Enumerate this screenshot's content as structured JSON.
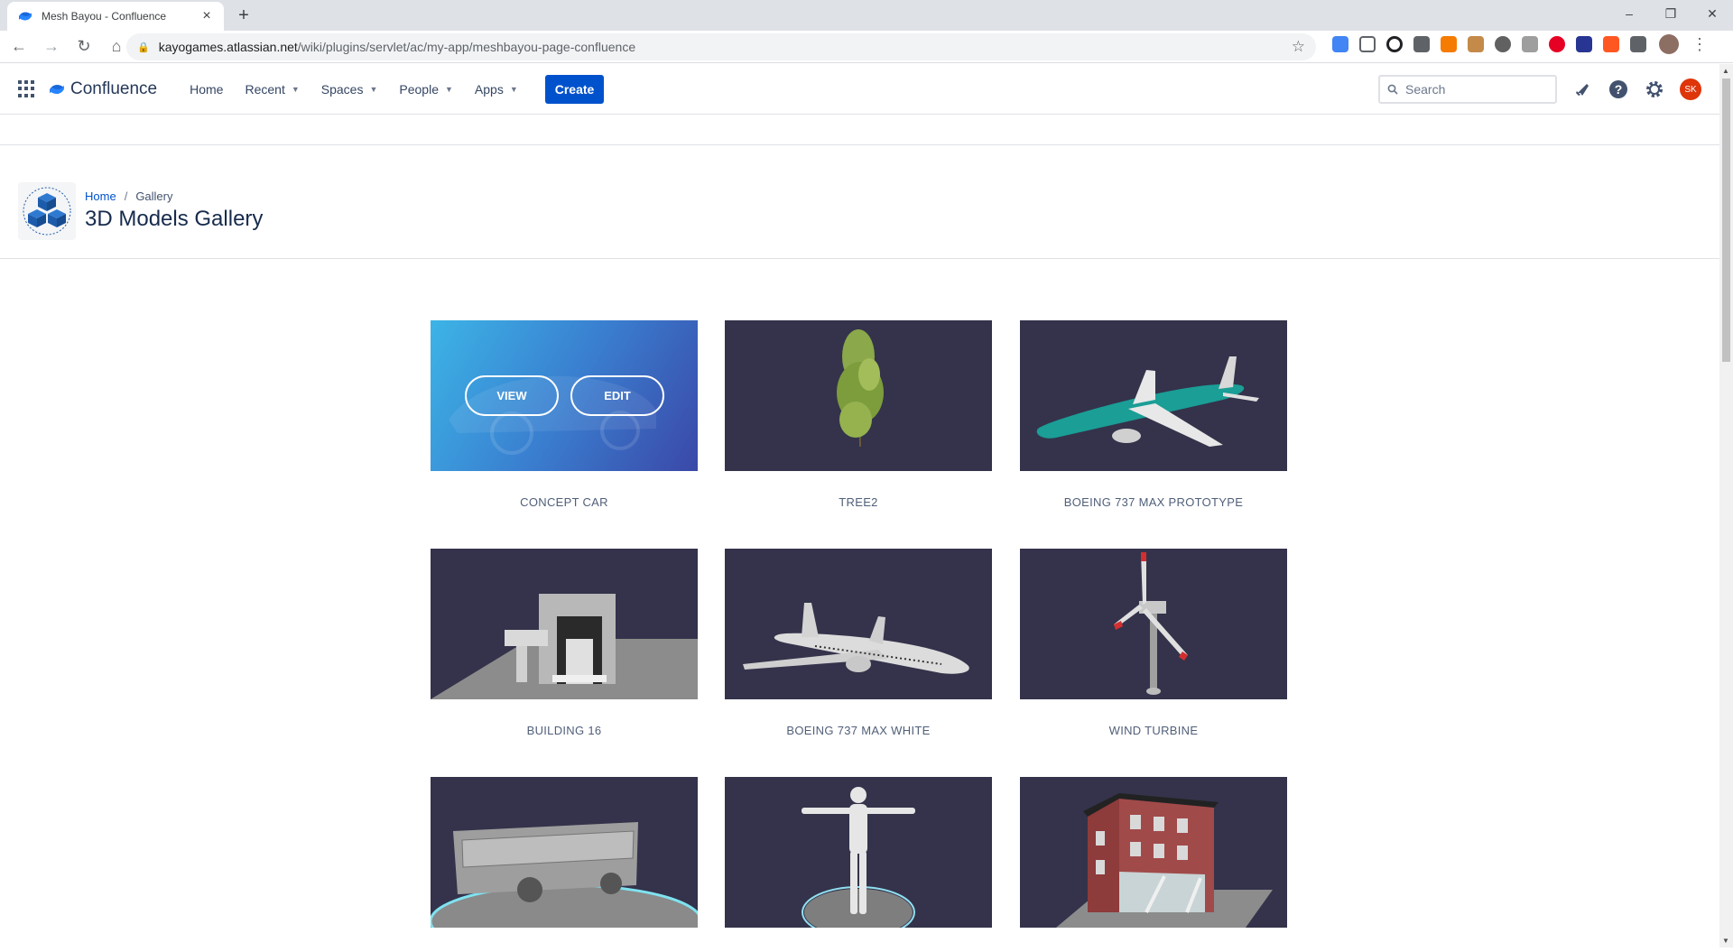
{
  "browser": {
    "tab_title": "Mesh Bayou - Confluence",
    "url_host": "kayogames.atlassian.net",
    "url_path": "/wiki/plugins/servlet/ac/my-app/meshbayou-page-confluence"
  },
  "header": {
    "logo_text": "Confluence",
    "nav": {
      "home": "Home",
      "recent": "Recent",
      "spaces": "Spaces",
      "people": "People",
      "apps": "Apps"
    },
    "create_label": "Create",
    "search_placeholder": "Search",
    "avatar_initials": "SK"
  },
  "page": {
    "breadcrumb_home": "Home",
    "breadcrumb_sep": "/",
    "breadcrumb_current": "Gallery",
    "title": "3D Models Gallery"
  },
  "gallery": {
    "view_label": "VIEW",
    "edit_label": "EDIT",
    "items": [
      {
        "caption": "CONCEPT CAR"
      },
      {
        "caption": "TREE2"
      },
      {
        "caption": "BOEING 737 MAX PROTOTYPE"
      },
      {
        "caption": "BUILDING 16"
      },
      {
        "caption": "BOEING 737 MAX WHITE"
      },
      {
        "caption": "WIND TURBINE"
      },
      {
        "caption": ""
      },
      {
        "caption": ""
      },
      {
        "caption": ""
      }
    ]
  },
  "colors": {
    "accent": "#0052cc",
    "thumb_bg": "#34334b",
    "avatar": "#de350b"
  }
}
